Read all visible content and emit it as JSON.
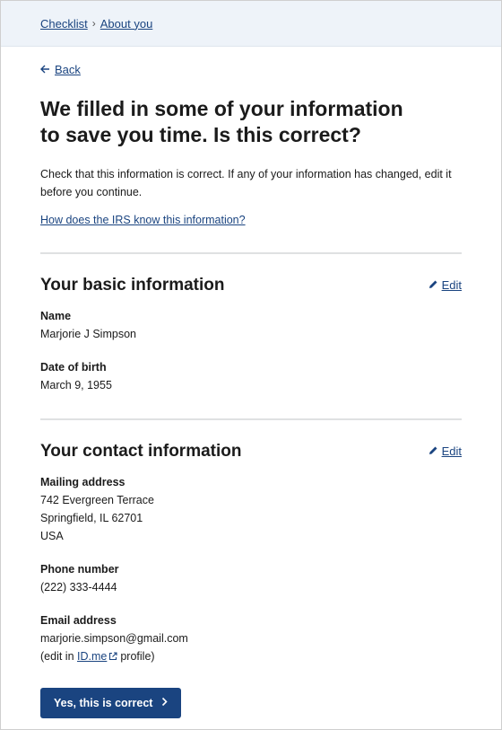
{
  "breadcrumb": {
    "items": [
      "Checklist",
      "About you"
    ],
    "separator": "›"
  },
  "back": {
    "label": "Back"
  },
  "title": "We filled in some of your information to save you time. Is this correct?",
  "intro": "Check that this information is correct. If any of your information has changed, edit it before you continue.",
  "irs_link": "How does the IRS know this information?",
  "basic": {
    "heading": "Your basic information",
    "edit": "Edit",
    "name_label": "Name",
    "name_value": "Marjorie J Simpson",
    "dob_label": "Date of birth",
    "dob_value": "March 9, 1955"
  },
  "contact": {
    "heading": "Your contact information",
    "edit": "Edit",
    "address_label": "Mailing address",
    "address_lines": [
      "742 Evergreen Terrace",
      "Springfield, IL 62701",
      "USA"
    ],
    "phone_label": "Phone number",
    "phone_value": "(222) 333-4444",
    "email_label": "Email address",
    "email_value": "marjorie.simpson@gmail.com",
    "email_note_prefix": "(edit in",
    "email_note_link": "ID.me",
    "email_note_suffix": "profile)"
  },
  "confirm_button": "Yes, this is correct",
  "colors": {
    "link": "#1a4480",
    "button_bg": "#1a4480",
    "breadcrumb_bg": "#eef3f9",
    "divider": "#dfe1e2"
  },
  "icons": {
    "back": "arrow-left-icon",
    "edit": "pencil-icon",
    "external": "external-link-icon",
    "button": "chevron-right-icon"
  }
}
